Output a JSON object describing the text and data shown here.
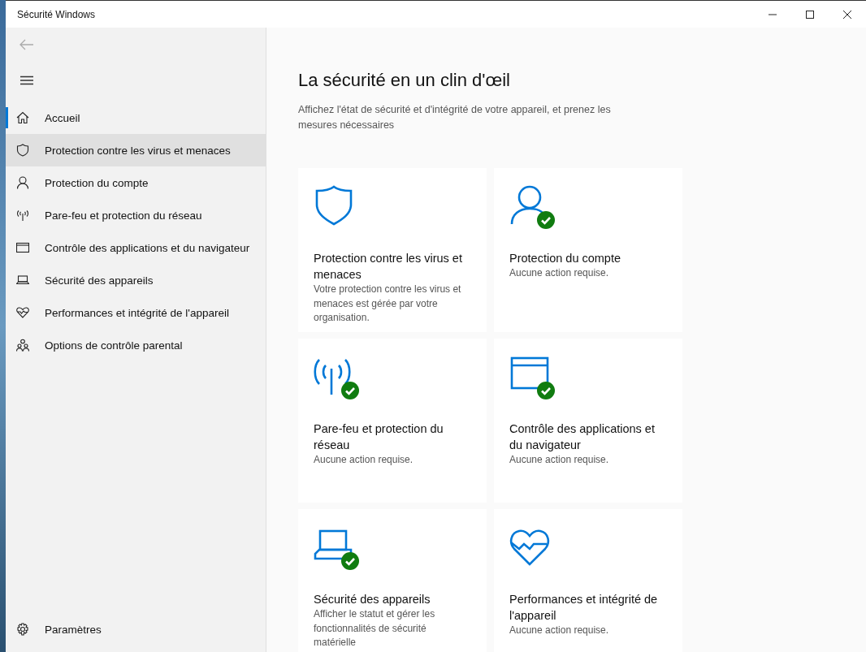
{
  "window": {
    "title": "Sécurité Windows"
  },
  "sidebar": {
    "items": [
      {
        "label": "Accueil",
        "selected": true,
        "hovered": false
      },
      {
        "label": "Protection contre les virus et menaces",
        "selected": false,
        "hovered": true
      },
      {
        "label": "Protection du compte",
        "selected": false,
        "hovered": false
      },
      {
        "label": "Pare-feu et protection du réseau",
        "selected": false,
        "hovered": false
      },
      {
        "label": "Contrôle des applications et du navigateur",
        "selected": false,
        "hovered": false
      },
      {
        "label": "Sécurité des appareils",
        "selected": false,
        "hovered": false
      },
      {
        "label": "Performances et intégrité de l'appareil",
        "selected": false,
        "hovered": false
      },
      {
        "label": "Options de contrôle parental",
        "selected": false,
        "hovered": false
      }
    ],
    "settings": {
      "label": "Paramètres"
    }
  },
  "main": {
    "heading": "La sécurité en un clin d'œil",
    "description": "Affichez l'état de sécurité et d'intégrité de votre appareil, et prenez les mesures nécessaires",
    "cards": [
      {
        "checked": false,
        "title": "Protection contre les virus et menaces",
        "status": "Votre protection contre les virus et menaces est gérée par votre organisation."
      },
      {
        "checked": true,
        "title": "Protection du compte",
        "status": "Aucune action requise."
      },
      {
        "checked": true,
        "title": "Pare-feu et protection du réseau",
        "status": "Aucune action requise."
      },
      {
        "checked": true,
        "title": "Contrôle des applications et du navigateur",
        "status": "Aucune action requise."
      },
      {
        "checked": true,
        "title": "Sécurité des appareils",
        "status": "Afficher le statut et gérer les fonctionnalités de sécurité matérielle"
      },
      {
        "checked": false,
        "title": "Performances et intégrité de l'appareil",
        "status": "Aucune action requise."
      }
    ]
  }
}
